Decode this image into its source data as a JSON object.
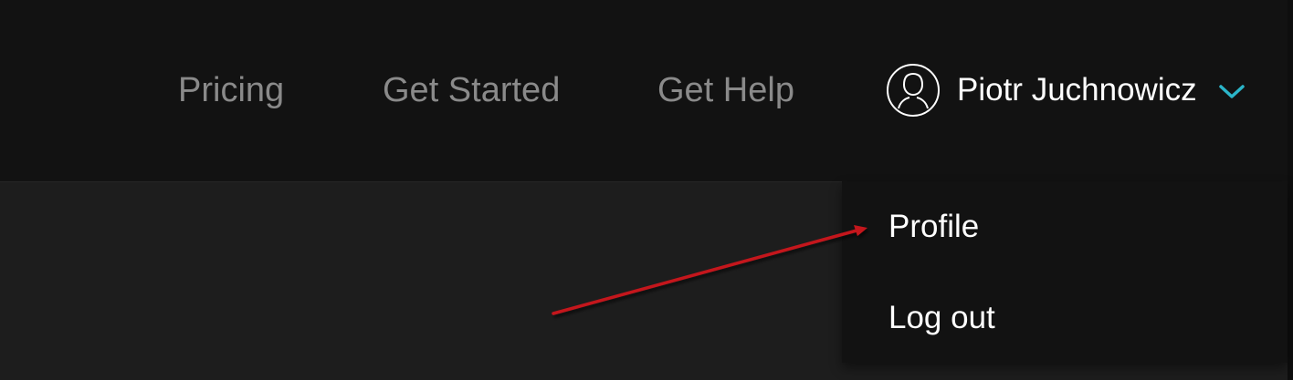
{
  "nav": {
    "links": [
      {
        "label": "Pricing"
      },
      {
        "label": "Get Started"
      },
      {
        "label": "Get Help"
      }
    ]
  },
  "user": {
    "name": "Piotr Juchnowicz",
    "avatar_icon": "user-silhouette-icon",
    "dropdown_icon": "chevron-down-icon",
    "accent_color": "#2bb5c9"
  },
  "dropdown": {
    "items": [
      {
        "label": "Profile"
      },
      {
        "label": "Log out"
      }
    ]
  },
  "annotation": {
    "arrow_color": "#c4161c"
  }
}
